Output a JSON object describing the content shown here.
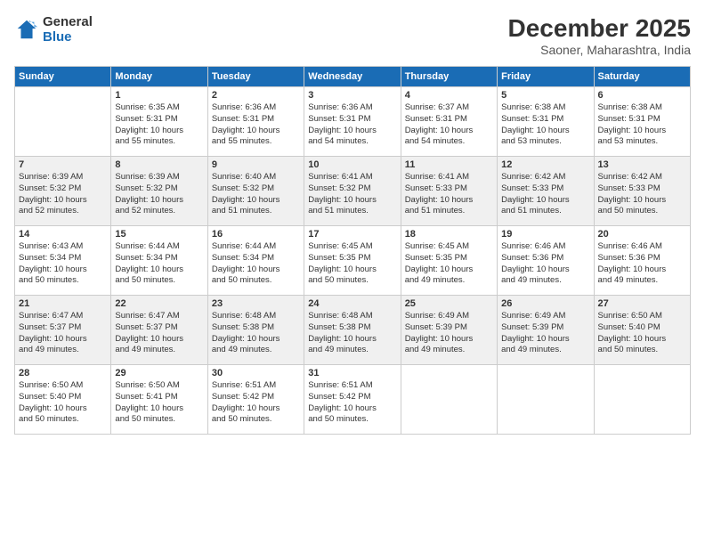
{
  "header": {
    "logo_line1": "General",
    "logo_line2": "Blue",
    "title": "December 2025",
    "location": "Saoner, Maharashtra, India"
  },
  "days_of_week": [
    "Sunday",
    "Monday",
    "Tuesday",
    "Wednesday",
    "Thursday",
    "Friday",
    "Saturday"
  ],
  "weeks": [
    [
      {
        "day": "",
        "info": ""
      },
      {
        "day": "1",
        "info": "Sunrise: 6:35 AM\nSunset: 5:31 PM\nDaylight: 10 hours\nand 55 minutes."
      },
      {
        "day": "2",
        "info": "Sunrise: 6:36 AM\nSunset: 5:31 PM\nDaylight: 10 hours\nand 55 minutes."
      },
      {
        "day": "3",
        "info": "Sunrise: 6:36 AM\nSunset: 5:31 PM\nDaylight: 10 hours\nand 54 minutes."
      },
      {
        "day": "4",
        "info": "Sunrise: 6:37 AM\nSunset: 5:31 PM\nDaylight: 10 hours\nand 54 minutes."
      },
      {
        "day": "5",
        "info": "Sunrise: 6:38 AM\nSunset: 5:31 PM\nDaylight: 10 hours\nand 53 minutes."
      },
      {
        "day": "6",
        "info": "Sunrise: 6:38 AM\nSunset: 5:31 PM\nDaylight: 10 hours\nand 53 minutes."
      }
    ],
    [
      {
        "day": "7",
        "info": "Sunrise: 6:39 AM\nSunset: 5:32 PM\nDaylight: 10 hours\nand 52 minutes."
      },
      {
        "day": "8",
        "info": "Sunrise: 6:39 AM\nSunset: 5:32 PM\nDaylight: 10 hours\nand 52 minutes."
      },
      {
        "day": "9",
        "info": "Sunrise: 6:40 AM\nSunset: 5:32 PM\nDaylight: 10 hours\nand 51 minutes."
      },
      {
        "day": "10",
        "info": "Sunrise: 6:41 AM\nSunset: 5:32 PM\nDaylight: 10 hours\nand 51 minutes."
      },
      {
        "day": "11",
        "info": "Sunrise: 6:41 AM\nSunset: 5:33 PM\nDaylight: 10 hours\nand 51 minutes."
      },
      {
        "day": "12",
        "info": "Sunrise: 6:42 AM\nSunset: 5:33 PM\nDaylight: 10 hours\nand 51 minutes."
      },
      {
        "day": "13",
        "info": "Sunrise: 6:42 AM\nSunset: 5:33 PM\nDaylight: 10 hours\nand 50 minutes."
      }
    ],
    [
      {
        "day": "14",
        "info": "Sunrise: 6:43 AM\nSunset: 5:34 PM\nDaylight: 10 hours\nand 50 minutes."
      },
      {
        "day": "15",
        "info": "Sunrise: 6:44 AM\nSunset: 5:34 PM\nDaylight: 10 hours\nand 50 minutes."
      },
      {
        "day": "16",
        "info": "Sunrise: 6:44 AM\nSunset: 5:34 PM\nDaylight: 10 hours\nand 50 minutes."
      },
      {
        "day": "17",
        "info": "Sunrise: 6:45 AM\nSunset: 5:35 PM\nDaylight: 10 hours\nand 50 minutes."
      },
      {
        "day": "18",
        "info": "Sunrise: 6:45 AM\nSunset: 5:35 PM\nDaylight: 10 hours\nand 49 minutes."
      },
      {
        "day": "19",
        "info": "Sunrise: 6:46 AM\nSunset: 5:36 PM\nDaylight: 10 hours\nand 49 minutes."
      },
      {
        "day": "20",
        "info": "Sunrise: 6:46 AM\nSunset: 5:36 PM\nDaylight: 10 hours\nand 49 minutes."
      }
    ],
    [
      {
        "day": "21",
        "info": "Sunrise: 6:47 AM\nSunset: 5:37 PM\nDaylight: 10 hours\nand 49 minutes."
      },
      {
        "day": "22",
        "info": "Sunrise: 6:47 AM\nSunset: 5:37 PM\nDaylight: 10 hours\nand 49 minutes."
      },
      {
        "day": "23",
        "info": "Sunrise: 6:48 AM\nSunset: 5:38 PM\nDaylight: 10 hours\nand 49 minutes."
      },
      {
        "day": "24",
        "info": "Sunrise: 6:48 AM\nSunset: 5:38 PM\nDaylight: 10 hours\nand 49 minutes."
      },
      {
        "day": "25",
        "info": "Sunrise: 6:49 AM\nSunset: 5:39 PM\nDaylight: 10 hours\nand 49 minutes."
      },
      {
        "day": "26",
        "info": "Sunrise: 6:49 AM\nSunset: 5:39 PM\nDaylight: 10 hours\nand 49 minutes."
      },
      {
        "day": "27",
        "info": "Sunrise: 6:50 AM\nSunset: 5:40 PM\nDaylight: 10 hours\nand 50 minutes."
      }
    ],
    [
      {
        "day": "28",
        "info": "Sunrise: 6:50 AM\nSunset: 5:40 PM\nDaylight: 10 hours\nand 50 minutes."
      },
      {
        "day": "29",
        "info": "Sunrise: 6:50 AM\nSunset: 5:41 PM\nDaylight: 10 hours\nand 50 minutes."
      },
      {
        "day": "30",
        "info": "Sunrise: 6:51 AM\nSunset: 5:42 PM\nDaylight: 10 hours\nand 50 minutes."
      },
      {
        "day": "31",
        "info": "Sunrise: 6:51 AM\nSunset: 5:42 PM\nDaylight: 10 hours\nand 50 minutes."
      },
      {
        "day": "",
        "info": ""
      },
      {
        "day": "",
        "info": ""
      },
      {
        "day": "",
        "info": ""
      }
    ]
  ]
}
